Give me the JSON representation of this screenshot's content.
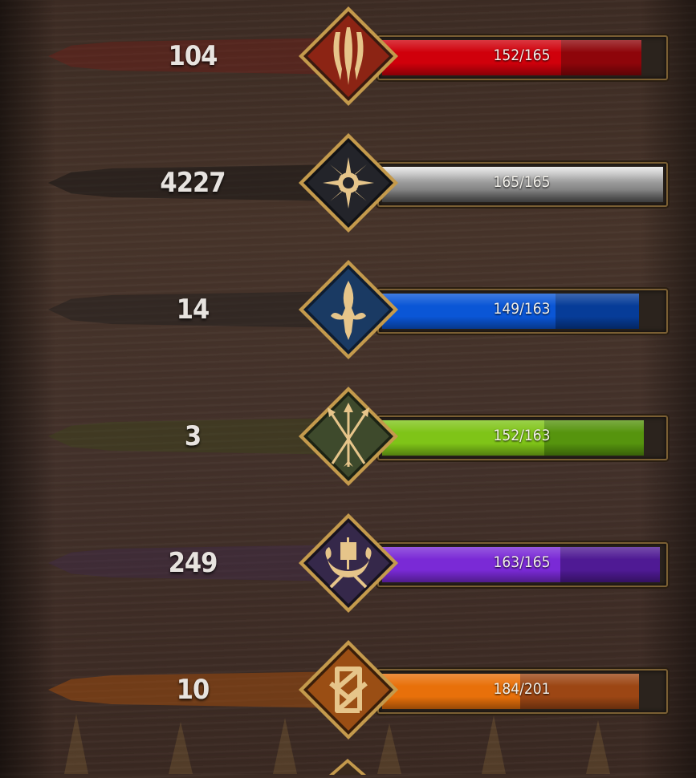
{
  "factions": [
    {
      "id": "monsters",
      "emblem_icon": "claw-icon",
      "count": "104",
      "current": 152,
      "max": 165,
      "value_label": "152/165",
      "fill_fraction": 0.92,
      "bar_color": "#d0000b",
      "bar_dark": "#8e050a",
      "frame_color": "#8c2414",
      "banner_color": "#7d1a14"
    },
    {
      "id": "nilfgaard",
      "emblem_icon": "sun-icon",
      "count": "4227",
      "current": 165,
      "max": 165,
      "value_label": "165/165",
      "fill_fraction": 1.0,
      "bar_color": "#9a9a9a",
      "bar_dark": "#cfcfcf",
      "frame_color": "#23242a",
      "banner_color": "#141414"
    },
    {
      "id": "northern-realms",
      "emblem_icon": "fleur-de-lis-icon",
      "count": "14",
      "current": 149,
      "max": 163,
      "value_label": "149/163",
      "fill_fraction": 0.914,
      "bar_color": "#0a56d6",
      "bar_dark": "#063c98",
      "frame_color": "#1a3a63",
      "banner_color": "#1c1c1c"
    },
    {
      "id": "scoiatael",
      "emblem_icon": "crossed-arrows-icon",
      "count": "3",
      "current": 152,
      "max": 163,
      "value_label": "152/163",
      "fill_fraction": 0.932,
      "bar_color": "#7fc418",
      "bar_dark": "#56940e",
      "frame_color": "#3e4a2c",
      "banner_color": "#3c4a18"
    },
    {
      "id": "skellige",
      "emblem_icon": "longship-icon",
      "count": "249",
      "current": 163,
      "max": 165,
      "value_label": "163/165",
      "fill_fraction": 0.988,
      "bar_color": "#7a2ad6",
      "bar_dark": "#4f1a94",
      "frame_color": "#35284a",
      "banner_color": "#3e2852"
    },
    {
      "id": "syndicate",
      "emblem_icon": "knot-icon",
      "count": "10",
      "current": 184,
      "max": 201,
      "value_label": "184/201",
      "fill_fraction": 0.915,
      "bar_color": "#e8700a",
      "bar_dark": "#9c4614",
      "frame_color": "#9a4e14",
      "banner_color": "#b2520c"
    }
  ],
  "colors": {
    "text": "#e7e3df",
    "frame_gold": "#c9a25a"
  }
}
